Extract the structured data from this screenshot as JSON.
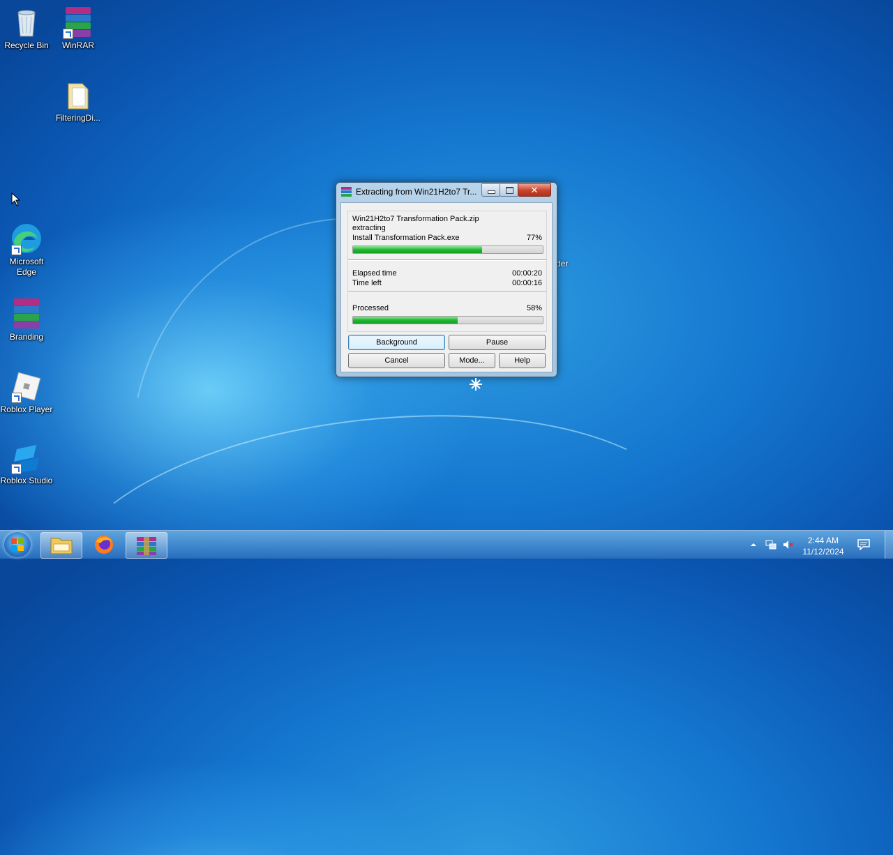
{
  "desktop": {
    "icons": [
      {
        "id": "recycle-bin",
        "label": "Recycle Bin"
      },
      {
        "id": "winrar",
        "label": "WinRAR"
      },
      {
        "id": "filtering",
        "label": "FilteringDi..."
      },
      {
        "id": "edge",
        "label": "Microsoft Edge"
      },
      {
        "id": "branding",
        "label": "Branding"
      },
      {
        "id": "roblox-player",
        "label": "Roblox Player"
      },
      {
        "id": "roblox-studio",
        "label": "Roblox Studio"
      }
    ],
    "partial_label": "der"
  },
  "dialog": {
    "title": "Extracting from Win21H2to7 Tr...",
    "archive_name": "Win21H2to7 Transformation Pack.zip",
    "action": "extracting",
    "current_file": "Install Transformation Pack.exe",
    "file_percent_text": "77%",
    "file_progress": 0.68,
    "elapsed_label": "Elapsed time",
    "elapsed_value": "00:00:20",
    "time_left_label": "Time left",
    "time_left_value": "00:00:16",
    "processed_label": "Processed",
    "processed_percent_text": "58%",
    "processed_progress": 0.55,
    "buttons": {
      "background": "Background",
      "pause": "Pause",
      "cancel": "Cancel",
      "mode": "Mode...",
      "help": "Help"
    },
    "caption_buttons": {
      "close": "✕"
    }
  },
  "taskbar": {
    "items": [
      "start-button",
      "file-explorer",
      "firefox",
      "winrar"
    ],
    "clock": {
      "time": "2:44 AM",
      "date": "11/12/2024"
    }
  },
  "colors": {
    "progress_green": "#21b830",
    "desktop_blue": "#1476cf",
    "close_red": "#c7422a"
  }
}
